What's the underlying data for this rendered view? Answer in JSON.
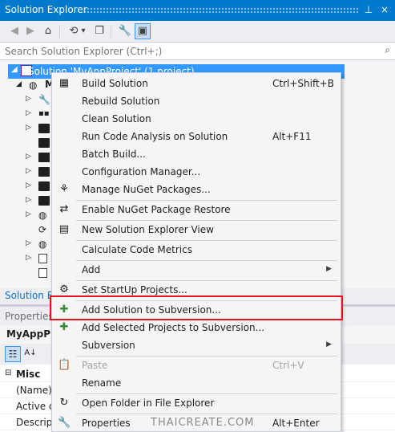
{
  "window": {
    "title": "Solution Explorer",
    "pin_glyph": "⊥",
    "close_glyph": "×"
  },
  "toolbar": {
    "back_glyph": "◀",
    "forward_glyph": "▶",
    "home_glyph": "⌂",
    "history_glyph": "⟲",
    "dropdown_glyph": "▾",
    "collapse_glyph": "❐",
    "properties_glyph": "🔧",
    "preview_glyph": "▣"
  },
  "search": {
    "placeholder": "Search Solution Explorer (Ctrl+;)",
    "icon_glyph": "⌕"
  },
  "tree": {
    "solution_label": "Solution 'MyAppProject' (1 project)",
    "project_label": "M"
  },
  "tabs": {
    "solution_explorer": "Solution E"
  },
  "properties": {
    "title": "Properties",
    "object": "MyAppPro",
    "categorized_glyph": "☷",
    "alpha_glyph": "A↓",
    "rows": [
      {
        "key": "Misc",
        "category": true
      },
      {
        "key": "(Name)"
      },
      {
        "key": "Active c"
      },
      {
        "key": "Descript"
      }
    ]
  },
  "context_menu": {
    "items": [
      {
        "label": "Build Solution",
        "shortcut": "Ctrl+Shift+B",
        "icon": "▦"
      },
      {
        "label": "Rebuild Solution",
        "shortcut": "",
        "icon": ""
      },
      {
        "label": "Clean Solution",
        "shortcut": "",
        "icon": ""
      },
      {
        "label": "Run Code Analysis on Solution",
        "shortcut": "Alt+F11",
        "icon": ""
      },
      {
        "label": "Batch Build...",
        "shortcut": "",
        "icon": ""
      },
      {
        "label": "Configuration Manager...",
        "shortcut": "",
        "icon": ""
      },
      {
        "label": "Manage NuGet Packages...",
        "shortcut": "",
        "icon": "⚘"
      },
      {
        "label": "Enable NuGet Package Restore",
        "shortcut": "",
        "icon": "⇄"
      },
      {
        "label": "New Solution Explorer View",
        "shortcut": "",
        "icon": "▤"
      },
      {
        "label": "Calculate Code Metrics",
        "shortcut": "",
        "icon": ""
      },
      {
        "label": "Add",
        "shortcut": "",
        "icon": ""
      },
      {
        "label": "Set StartUp Projects...",
        "shortcut": "",
        "icon": "⚙"
      },
      {
        "label": "Add Solution to Subversion...",
        "shortcut": "",
        "icon": "✚"
      },
      {
        "label": "Add Selected Projects to Subversion...",
        "shortcut": "",
        "icon": "✚"
      },
      {
        "label": "Subversion",
        "shortcut": "",
        "icon": ""
      },
      {
        "label": "Paste",
        "shortcut": "Ctrl+V",
        "icon": "📋"
      },
      {
        "label": "Rename",
        "shortcut": "",
        "icon": ""
      },
      {
        "label": "Open Folder in File Explorer",
        "shortcut": "",
        "icon": "↻"
      },
      {
        "label": "Properties",
        "shortcut": "Alt+Enter",
        "icon": "🔧"
      }
    ],
    "submenu_glyph": "▶"
  },
  "watermark": "THAICREATE.COM",
  "colors": {
    "accent": "#007ACC",
    "selection": "#3399FF",
    "highlight_box": "#E3141B"
  }
}
